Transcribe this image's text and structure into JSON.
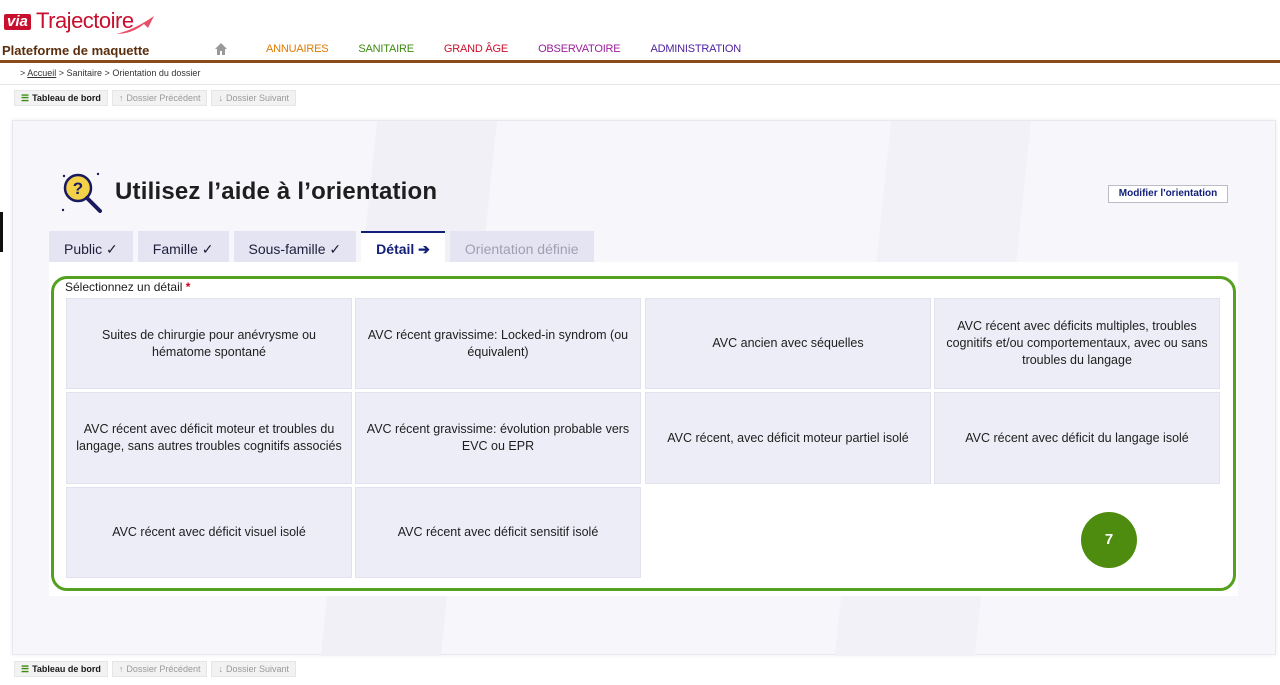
{
  "header": {
    "logo_via": "via",
    "logo_traj": "Trajectoire",
    "platform": "Plateforme de maquette",
    "nav": [
      "ANNUAIRES",
      "SANITAIRE",
      "GRAND ÂGE",
      "OBSERVATOIRE",
      "ADMINISTRATION"
    ],
    "colors": {
      "annuaires": "#e07a00",
      "sanitaire": "#3d8b12",
      "grandage": "#c8102e",
      "observatoire": "#9b1f9b",
      "administration": "#4b1fa0",
      "bar": "#8a4a1a"
    }
  },
  "breadcrumb": {
    "home": "Accueil",
    "rest": " > Sanitaire > Orientation du dossier",
    "lead": " > "
  },
  "toolbar": {
    "dashboard": "Tableau de bord",
    "previous": "Dossier Précédent",
    "next": "Dossier Suivant"
  },
  "main": {
    "title": "Utilisez l’aide à l’orientation",
    "modify_button": "Modifier l'orientation",
    "tabs": [
      "Public ✓",
      "Famille ✓",
      "Sous-famille ✓",
      "Détail ➔",
      "Orientation définie"
    ],
    "active_tab": "Détail ➔",
    "select_label": "Sélectionnez un détail",
    "required_mark": "*",
    "options": [
      "Suites de chirurgie pour anévrysme ou hématome spontané",
      "AVC récent gravissime: Locked-in syndrom (ou équivalent)",
      "AVC ancien avec séquelles",
      "AVC récent avec déficits multiples, troubles cognitifs et/ou comportementaux, avec ou sans troubles du langage",
      "AVC récent avec déficit moteur et troubles du langage, sans autres troubles cognitifs associés",
      "AVC récent gravissime: évolution probable vers EVC ou EPR",
      "AVC récent, avec déficit moteur partiel isolé",
      "AVC récent avec déficit du langage isolé",
      "AVC récent avec déficit visuel isolé",
      "AVC récent avec déficit sensitif isolé"
    ],
    "badge": "7",
    "accent": "#55a01e"
  }
}
